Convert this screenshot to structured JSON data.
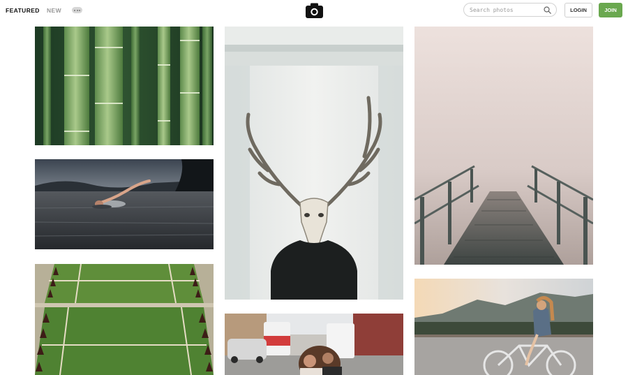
{
  "nav": {
    "featured": "FEATURED",
    "new": "NEW"
  },
  "logo_icon": "camera-icon",
  "search": {
    "placeholder": "Search photos",
    "icon": "search-icon"
  },
  "buttons": {
    "login": "LOGIN",
    "join": "JOIN"
  },
  "colors": {
    "join": "#6aa84f",
    "nav_active": "#111111",
    "nav_inactive": "#999999"
  },
  "photos": [
    {
      "subject": "bamboo stalks"
    },
    {
      "subject": "swimmer in lake"
    },
    {
      "subject": "grass terraces"
    },
    {
      "subject": "deer skull antlers person"
    },
    {
      "subject": "city street mother child"
    },
    {
      "subject": "foggy wooden bridge"
    },
    {
      "subject": "woman on bicycle"
    }
  ]
}
